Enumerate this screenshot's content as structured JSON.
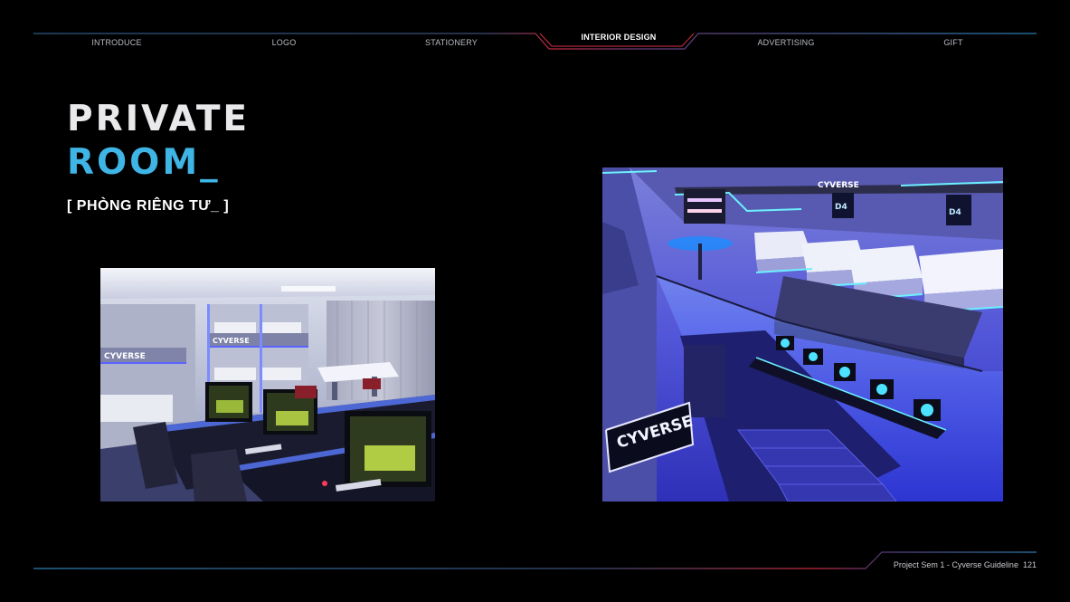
{
  "nav": {
    "items": [
      "INTRODUCE",
      "LOGO",
      "STATIONERY",
      "INTERIOR DESIGN",
      "ADVERTISING",
      "GIFT"
    ],
    "active_index": 3
  },
  "title": {
    "line1": "PRIVATE",
    "line2": "ROOM",
    "line2_cursor": "_",
    "subtitle": "[ PHÒNG RIÊNG TƯ_ ]"
  },
  "images": {
    "left": {
      "sign_text": "CYVERSE"
    },
    "right": {
      "sign_text": "CYVERSE",
      "top_sign": "CYVERSE",
      "room_label": "D4"
    }
  },
  "footer": {
    "caption": "Project Sem 1 - Cyverse Guideline",
    "page_number": "121"
  },
  "colors": {
    "background": "#000000",
    "accent_blue": "#3fb5e6",
    "accent_red": "#c8283c",
    "room_blue": "#3a3fe0"
  }
}
